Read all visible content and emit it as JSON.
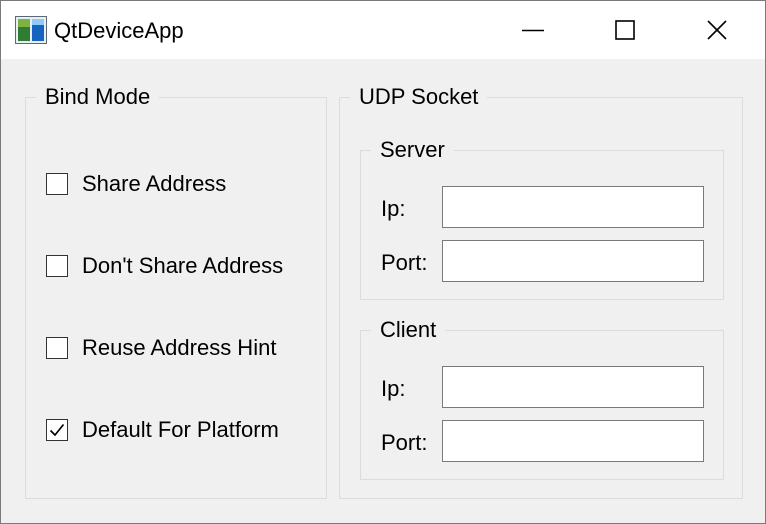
{
  "window": {
    "title": "QtDeviceApp"
  },
  "title_controls": {
    "minimize_icon": "minimize-icon",
    "maximize_icon": "maximize-icon",
    "close_icon": "close-icon"
  },
  "bind_mode": {
    "title": "Bind Mode",
    "options": [
      {
        "label": "Share Address",
        "checked": false
      },
      {
        "label": "Don't Share Address",
        "checked": false
      },
      {
        "label": "Reuse Address Hint",
        "checked": false
      },
      {
        "label": "Default For Platform",
        "checked": true
      }
    ]
  },
  "udp_socket": {
    "title": "UDP Socket",
    "server": {
      "title": "Server",
      "ip_label": "Ip:",
      "ip_value": "",
      "port_label": "Port:",
      "port_value": ""
    },
    "client": {
      "title": "Client",
      "ip_label": "Ip:",
      "ip_value": "",
      "port_label": "Port:",
      "port_value": ""
    }
  },
  "colors": {
    "titlebar_bg": "#ffffff",
    "window_bg": "#f0f0f0",
    "groupbox_border": "#dcdcdc",
    "input_border": "#7a7a7a"
  }
}
